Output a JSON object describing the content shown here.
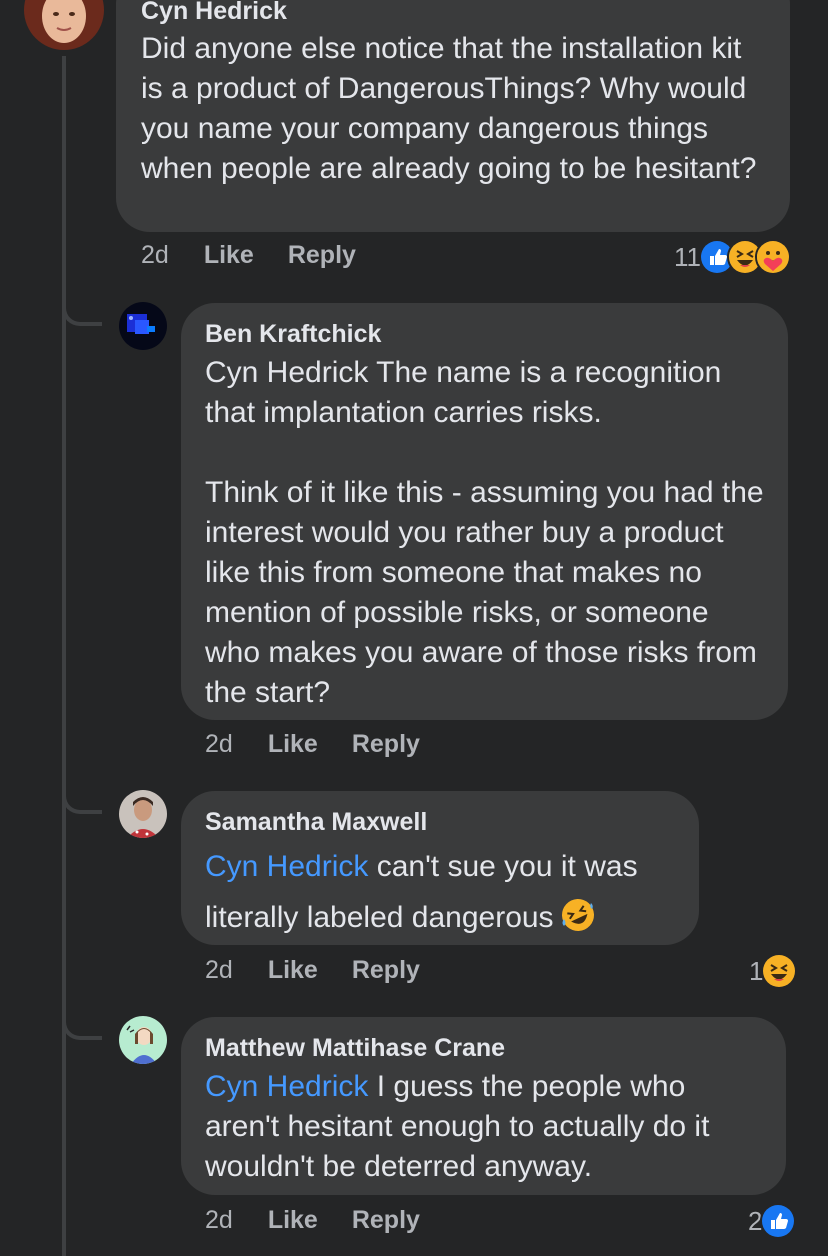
{
  "comments": [
    {
      "author": "Cyn Hedrick",
      "text": "Did anyone else notice that the installation kit is a product of DangerousThings? Why would you name your company dangerous things when people are already going to be hesitant?",
      "time": "2d",
      "like_label": "Like",
      "reply_label": "Reply",
      "reaction_count": "11",
      "reactions": [
        "like-icon",
        "haha-icon",
        "care-icon"
      ]
    }
  ],
  "replies": [
    {
      "author": "Ben Kraftchick",
      "mention": "",
      "text": "Cyn Hedrick The name is a recognition that implantation carries risks.\n\nThink of it like this - assuming you had the interest would you rather buy a product like this from someone that makes no mention of possible risks, or someone who makes you aware of those risks from the start?",
      "time": "2d",
      "like_label": "Like",
      "reply_label": "Reply",
      "reaction_count": "",
      "reactions": []
    },
    {
      "author": "Samantha Maxwell",
      "mention": "Cyn Hedrick",
      "text": " can't sue you it was literally labeled dangerous",
      "inline_emoji": "rolling-on-floor-laughing-emoji",
      "time": "2d",
      "like_label": "Like",
      "reply_label": "Reply",
      "reaction_count": "1",
      "reactions": [
        "haha-icon"
      ]
    },
    {
      "author": "Matthew Mattihase Crane",
      "mention": "Cyn Hedrick",
      "text": " I guess the people who aren't hesitant enough to actually do it wouldn't be deterred anyway.",
      "time": "2d",
      "like_label": "Like",
      "reply_label": "Reply",
      "reaction_count": "2",
      "reactions": [
        "like-icon"
      ]
    }
  ],
  "colors": {
    "background": "#242526",
    "bubble": "#3a3b3c",
    "text": "#e4e6eb",
    "secondary_text": "#b0b3b8",
    "mention": "#4599ff",
    "like_blue": "#1877f2",
    "emoji_yellow": "#f7b125"
  }
}
